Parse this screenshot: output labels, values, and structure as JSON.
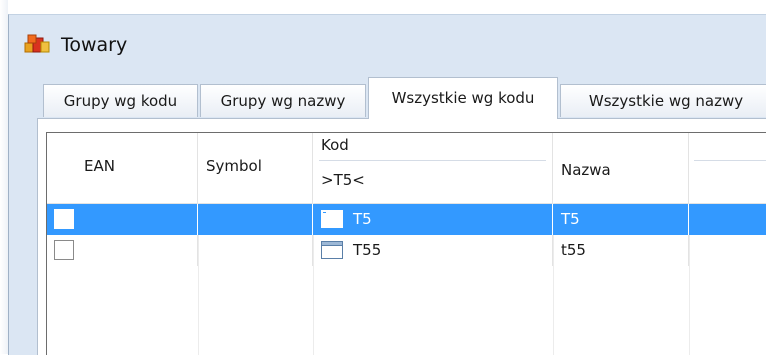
{
  "window": {
    "title": "Towary",
    "icon": "product-boxes-icon"
  },
  "tabs": [
    {
      "label": "Grupy wg kodu",
      "active": false
    },
    {
      "label": "Grupy wg nazwy",
      "active": false
    },
    {
      "label": "Wszystkie wg kodu",
      "active": true
    },
    {
      "label": "Wszystkie wg nazwy",
      "active": false
    }
  ],
  "grid": {
    "columns": {
      "ean": "EAN",
      "symbol": "Symbol",
      "kod": "Kod",
      "kod_filter": ">T5<",
      "nazwa": "Nazwa"
    },
    "rows": [
      {
        "checked": false,
        "ean": "",
        "symbol": "",
        "kod": "T5",
        "nazwa": "T5",
        "selected": true,
        "kod_icon": "window-item-icon"
      },
      {
        "checked": false,
        "ean": "",
        "symbol": "",
        "kod": "T55",
        "nazwa": "t55",
        "selected": false,
        "kod_icon": "window-item-icon"
      }
    ]
  },
  "colors": {
    "selection": "#3399ff",
    "window_bg": "#dbe6f3"
  }
}
